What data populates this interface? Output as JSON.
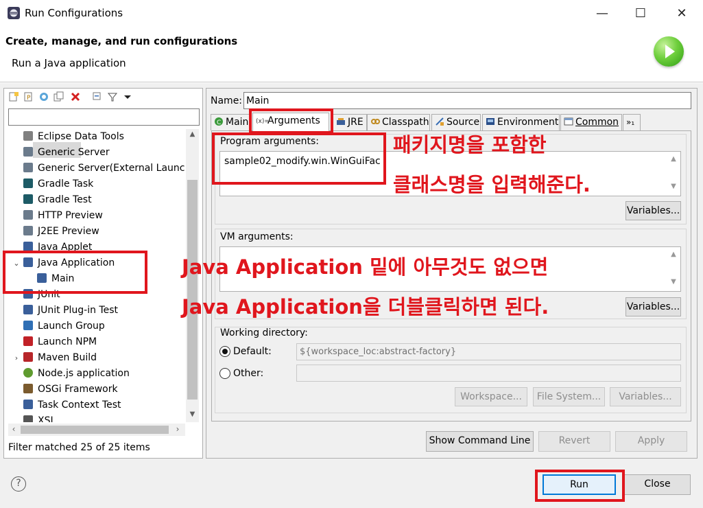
{
  "window": {
    "title": "Run Configurations",
    "minimize": "—",
    "maximize": "☐",
    "close": "✕"
  },
  "header": {
    "title": "Create, manage, and run configurations",
    "subtitle": "Run a Java application"
  },
  "left": {
    "filter_value": "",
    "tree": [
      {
        "label": "Eclipse Data Tools",
        "icon": "database-icon",
        "color": "#808080"
      },
      {
        "label": "Generic Server",
        "icon": "server-icon",
        "color": "#6b7b8c"
      },
      {
        "label": "Generic Server(External Launch)",
        "icon": "server-icon",
        "color": "#6b7b8c"
      },
      {
        "label": "Gradle Task",
        "icon": "gradle-icon",
        "color": "#1d5b66"
      },
      {
        "label": "Gradle Test",
        "icon": "gradle-icon",
        "color": "#1d5b66"
      },
      {
        "label": "HTTP Preview",
        "icon": "server-icon",
        "color": "#6b7b8c"
      },
      {
        "label": "J2EE Preview",
        "icon": "server-icon",
        "color": "#6b7b8c"
      },
      {
        "label": "Java Applet",
        "icon": "applet-icon",
        "color": "#3a5f9a"
      },
      {
        "label": "Java Application",
        "icon": "java-app-icon",
        "color": "#3a5f9a"
      },
      {
        "label": "Main",
        "icon": "java-app-icon",
        "color": "#3a5f9a"
      },
      {
        "label": "JUnit",
        "icon": "junit-icon",
        "color": "#3a5f9a"
      },
      {
        "label": "JUnit Plug-in Test",
        "icon": "junit-icon",
        "color": "#3a5f9a"
      },
      {
        "label": "Launch Group",
        "icon": "launch-group-icon",
        "color": "#2f6fb5"
      },
      {
        "label": "Launch NPM",
        "icon": "npm-icon",
        "color": "#c12127"
      },
      {
        "label": "Maven Build",
        "icon": "maven-icon",
        "color": "#b7262a"
      },
      {
        "label": "Node.js application",
        "icon": "nodejs-icon",
        "color": "#5f9b2f"
      },
      {
        "label": "OSGi Framework",
        "icon": "osgi-icon",
        "color": "#7b5b2e"
      },
      {
        "label": "Task Context Test",
        "icon": "junit-icon",
        "color": "#3a5f9a"
      },
      {
        "label": "XSL",
        "icon": "xsl-icon",
        "color": "#555555"
      }
    ],
    "status": "Filter matched 25 of 25 items"
  },
  "right": {
    "name_label": "Name:",
    "name_value": "Main",
    "tabs": [
      "Main",
      "Arguments",
      "JRE",
      "Classpath",
      "Source",
      "Environment",
      "Common",
      "»₁"
    ],
    "program_args_label": "Program arguments:",
    "program_args_value": "sample02_modify.win.WinGuiFac",
    "variables": "Variables...",
    "vm_args_label": "VM arguments:",
    "working_dir_label": "Working directory:",
    "default_label": "Default:",
    "default_value": "${workspace_loc:abstract-factory}",
    "other_label": "Other:",
    "workspace_btn": "Workspace...",
    "filesystem_btn": "File System...",
    "show_cmd": "Show Command Line",
    "revert": "Revert",
    "apply": "Apply"
  },
  "footer": {
    "help": "?",
    "run": "Run",
    "close": "Close"
  },
  "annotations": {
    "a1": "패키지명을 포함한",
    "a2": "클래스명을 입력해준다.",
    "a3": "Java Application 밑에 아무것도 없으면",
    "a4": "Java Application을 더블클릭하면 된다."
  },
  "colors": {
    "annotation": "#e0161d",
    "selection": "#d9d9d9",
    "run_accent": "#6fcf3d"
  }
}
